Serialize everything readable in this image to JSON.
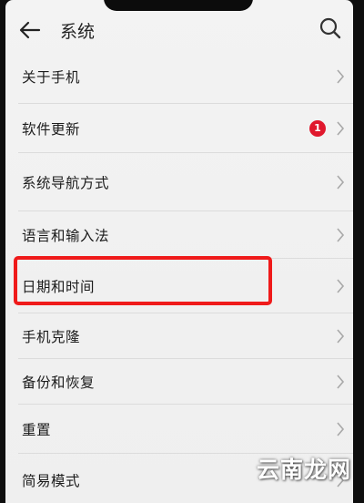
{
  "header": {
    "title": "系统",
    "back_icon": "arrow-left-icon",
    "search_icon": "search-icon"
  },
  "list": {
    "items": [
      {
        "label": "关于手机"
      },
      {
        "label": "软件更新",
        "badge": "1"
      },
      {
        "label": "系统导航方式"
      },
      {
        "label": "语言和输入法"
      },
      {
        "label": "日期和时间",
        "highlighted": true
      },
      {
        "label": "手机克隆"
      },
      {
        "label": "备份和恢复"
      },
      {
        "label": "重置"
      },
      {
        "label": "简易模式"
      }
    ]
  },
  "watermark": "云南龙网",
  "colors": {
    "background": "#f1f1f1",
    "badge": "#e0182d",
    "highlight_box": "#ef1a1a"
  }
}
